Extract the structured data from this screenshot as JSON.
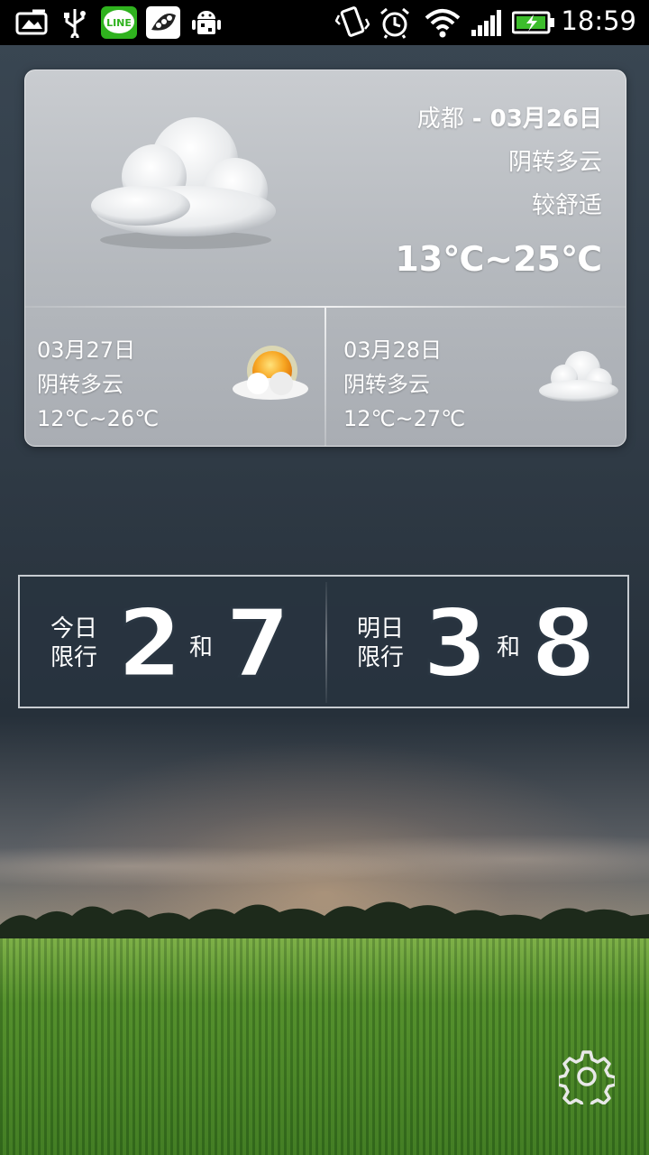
{
  "status_bar": {
    "time": "18:59",
    "icons": [
      "screenshot-icon",
      "usb-icon",
      "line-app-icon",
      "peapod-app-icon",
      "android-debug-icon",
      "vibrate-icon",
      "alarm-icon",
      "wifi-icon",
      "signal-icon",
      "battery-charging-icon"
    ],
    "line_label": "LINE"
  },
  "weather": {
    "city": "成都",
    "separator": " - ",
    "date": "03月26日",
    "condition": "阴转多云",
    "comfort": "较舒适",
    "temp_range": "13℃~25℃",
    "icon": "cloudy-icon",
    "forecast": [
      {
        "date": "03月27日",
        "condition": "阴转多云",
        "temp_range": "12℃~26℃",
        "icon": "sun-behind-cloud-icon"
      },
      {
        "date": "03月28日",
        "condition": "阴转多云",
        "temp_range": "12℃~27℃",
        "icon": "cloudy-icon"
      }
    ]
  },
  "traffic_limit": {
    "today": {
      "label_line1": "今日",
      "label_line2": "限行",
      "digit1": "2",
      "and": "和",
      "digit2": "7"
    },
    "tomorrow": {
      "label_line1": "明日",
      "label_line2": "限行",
      "digit1": "3",
      "and": "和",
      "digit2": "8"
    }
  },
  "settings": {
    "icon": "gear-icon"
  }
}
